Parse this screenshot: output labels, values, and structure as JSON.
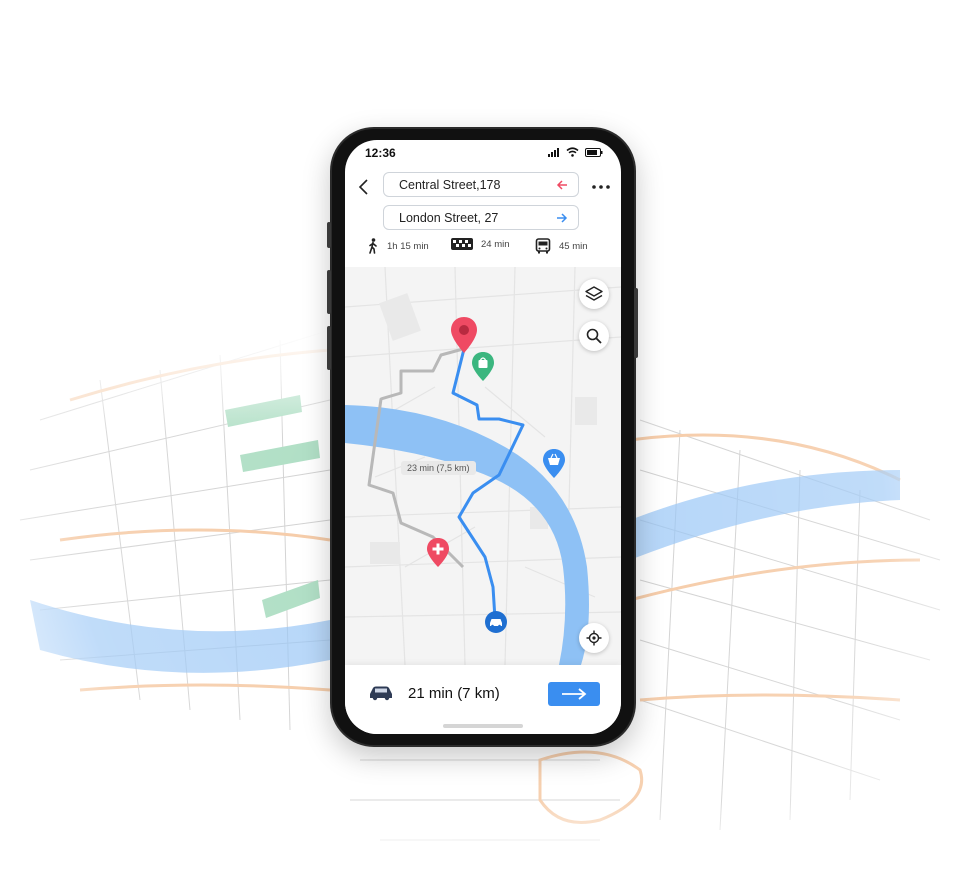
{
  "status_bar": {
    "time": "12:36",
    "signal_icon": "signal-icon",
    "wifi_icon": "wifi-icon",
    "battery_icon": "battery-icon"
  },
  "route": {
    "origin": "Central Street,178",
    "destination": "London Street, 27",
    "origin_icon": "arrow-left-icon",
    "destination_icon": "arrow-right-icon"
  },
  "modes": [
    {
      "icon": "walk-icon",
      "duration": "1h 15 min"
    },
    {
      "icon": "taxi-icon",
      "duration": "24 min"
    },
    {
      "icon": "bus-icon",
      "duration": "45 min"
    }
  ],
  "map": {
    "alt_route_label": "23 min (7,5 km)",
    "controls": [
      "layers-icon",
      "search-icon",
      "locate-icon"
    ],
    "markers": [
      "destination-pin-icon",
      "shopping-bag-icon",
      "basket-icon",
      "hospital-icon",
      "car-icon"
    ]
  },
  "bottom": {
    "summary": "21 min (7 km)",
    "vehicle_icon": "car-icon",
    "go_icon": "arrow-right-icon"
  },
  "colors": {
    "accent_blue": "#3a8ef0",
    "river": "#8ec1f5",
    "alt_route": "#b8b8b8",
    "pin_red": "#ef4a63",
    "pin_green": "#3bb67f",
    "street_orange": "#f5c8a2"
  }
}
